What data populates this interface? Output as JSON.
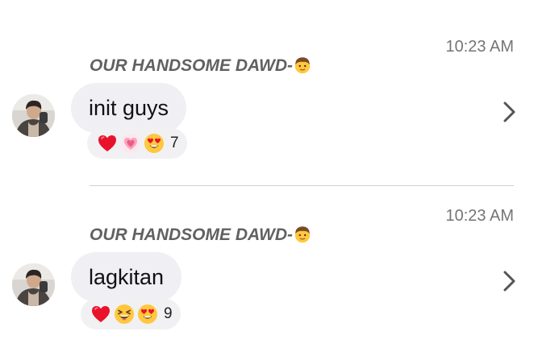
{
  "messages": [
    {
      "time": "10:23 AM",
      "sender": "OUR HANDSOME DAWD-",
      "sender_emoji": "man-emoji",
      "text": "init guys",
      "reactions": [
        "red-heart-emoji",
        "sparkling-heart-emoji",
        "heart-eyes-emoji"
      ],
      "reaction_count": "7"
    },
    {
      "time": "10:23 AM",
      "sender": "OUR HANDSOME DAWD-",
      "sender_emoji": "man-emoji",
      "text": "lagkitan",
      "reactions": [
        "red-heart-emoji",
        "laughing-emoji",
        "heart-eyes-emoji"
      ],
      "reaction_count": "9"
    }
  ],
  "colors": {
    "bubble": "#efeff4",
    "time": "#757575",
    "sender": "#616161",
    "divider": "#cfcfcf"
  }
}
